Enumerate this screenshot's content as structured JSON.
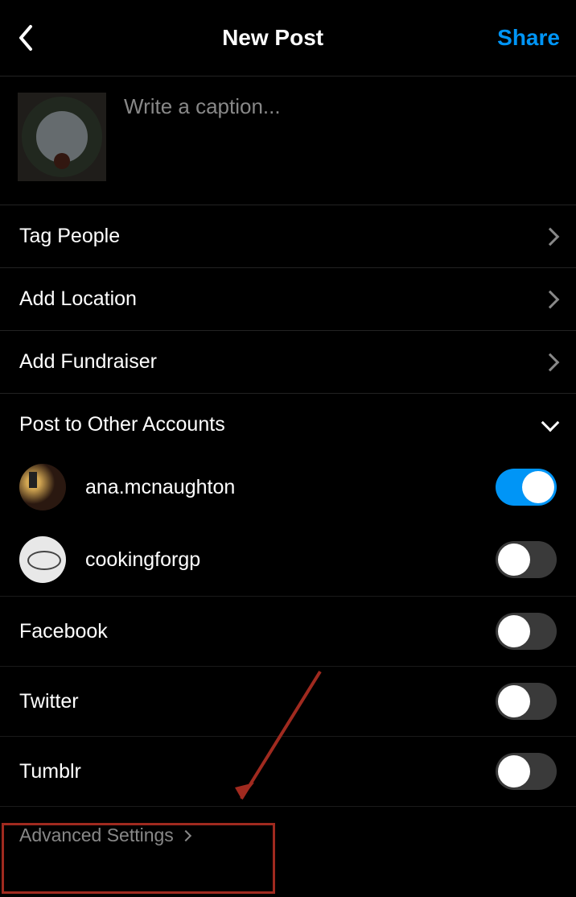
{
  "header": {
    "title": "New Post",
    "share": "Share"
  },
  "caption": {
    "placeholder": "Write a caption..."
  },
  "options": {
    "tag_people": "Tag People",
    "add_location": "Add Location",
    "add_fundraiser": "Add Fundraiser"
  },
  "accounts_section": {
    "title": "Post to Other Accounts",
    "items": [
      {
        "name": "ana.mcnaughton",
        "on": true
      },
      {
        "name": "cookingforgp",
        "on": false
      }
    ]
  },
  "socials": [
    {
      "name": "Facebook",
      "on": false
    },
    {
      "name": "Twitter",
      "on": false
    },
    {
      "name": "Tumblr",
      "on": false
    }
  ],
  "advanced": "Advanced Settings"
}
